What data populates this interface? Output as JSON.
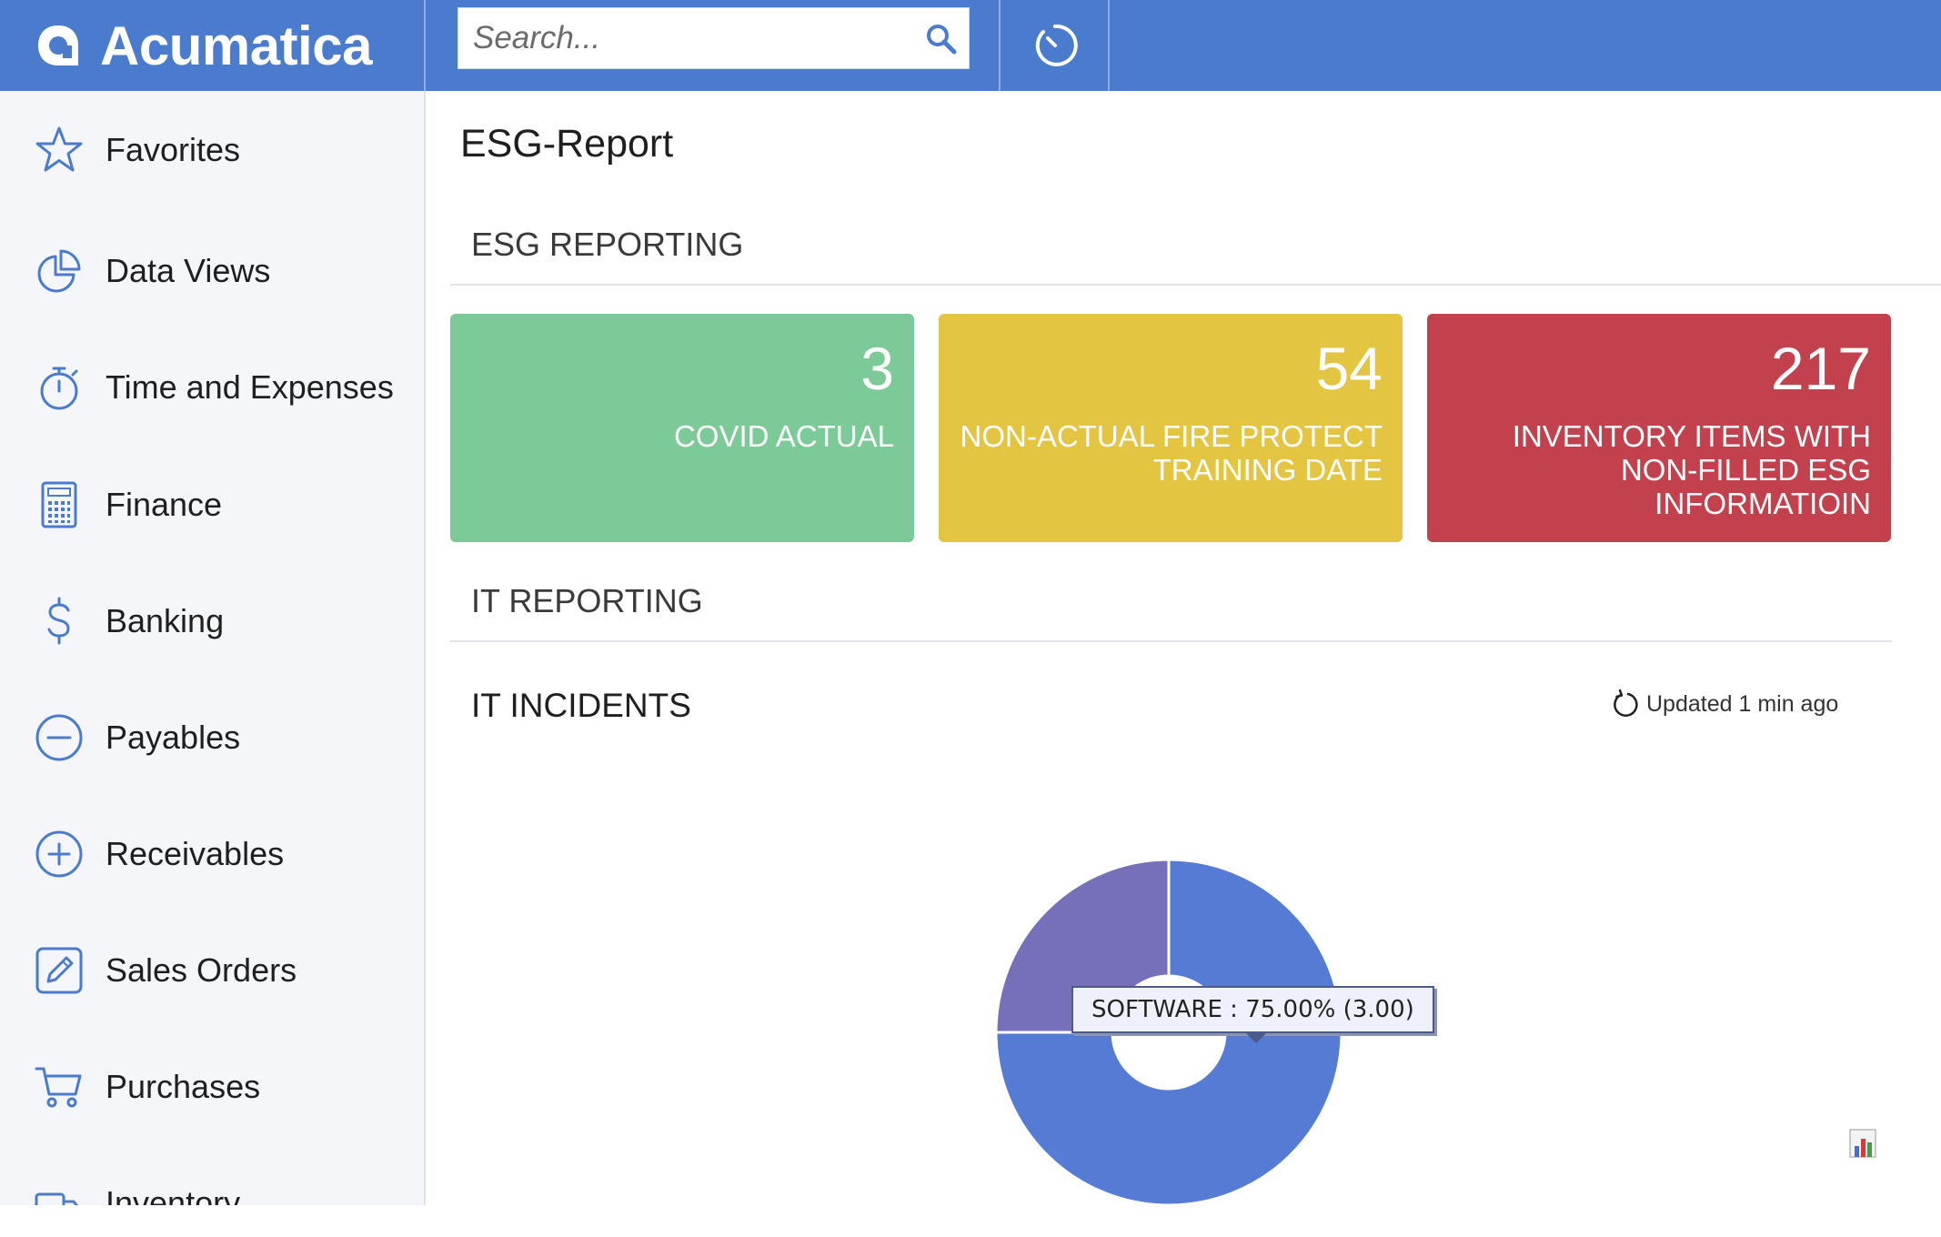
{
  "app": {
    "name": "Acumatica"
  },
  "search": {
    "placeholder": "Search..."
  },
  "sidebar": {
    "items": [
      {
        "label": "Favorites",
        "icon": "star-icon"
      },
      {
        "label": "Data Views",
        "icon": "pie-chart-icon"
      },
      {
        "label": "Time and Expenses",
        "icon": "stopwatch-icon"
      },
      {
        "label": "Finance",
        "icon": "calculator-icon"
      },
      {
        "label": "Banking",
        "icon": "dollar-icon"
      },
      {
        "label": "Payables",
        "icon": "minus-circle-icon"
      },
      {
        "label": "Receivables",
        "icon": "plus-circle-icon"
      },
      {
        "label": "Sales Orders",
        "icon": "edit-icon"
      },
      {
        "label": "Purchases",
        "icon": "cart-icon"
      },
      {
        "label": "Inventory",
        "icon": "truck-icon"
      }
    ]
  },
  "page": {
    "title": "ESG-Report"
  },
  "sections": {
    "esg": "ESG REPORTING",
    "it": "IT REPORTING"
  },
  "tiles": [
    {
      "value": "3",
      "label": "COVID ACTUAL",
      "color": "#7cca98"
    },
    {
      "value": "54",
      "label": "NON-ACTUAL FIRE PROTECT TRAINING DATE",
      "color": "#e3c542"
    },
    {
      "value": "217",
      "label": "INVENTORY ITEMS WITH NON-FILLED ESG INFORMATIOIN",
      "color": "#c3404d"
    }
  ],
  "widget": {
    "title": "IT INCIDENTS",
    "updated": "Updated 1 min ago",
    "tooltip": "SOFTWARE : 75.00% (3.00)"
  },
  "chart_data": {
    "type": "pie",
    "donut": true,
    "series": [
      {
        "name": "SOFTWARE",
        "value": 3,
        "percent": 75.0,
        "color": "#567bd4"
      },
      {
        "value": 1,
        "percent": 25.0,
        "color": "#7570b9"
      }
    ]
  },
  "colors": {
    "topbar": "#4a7bcc",
    "accent": "#4a7bcc"
  }
}
